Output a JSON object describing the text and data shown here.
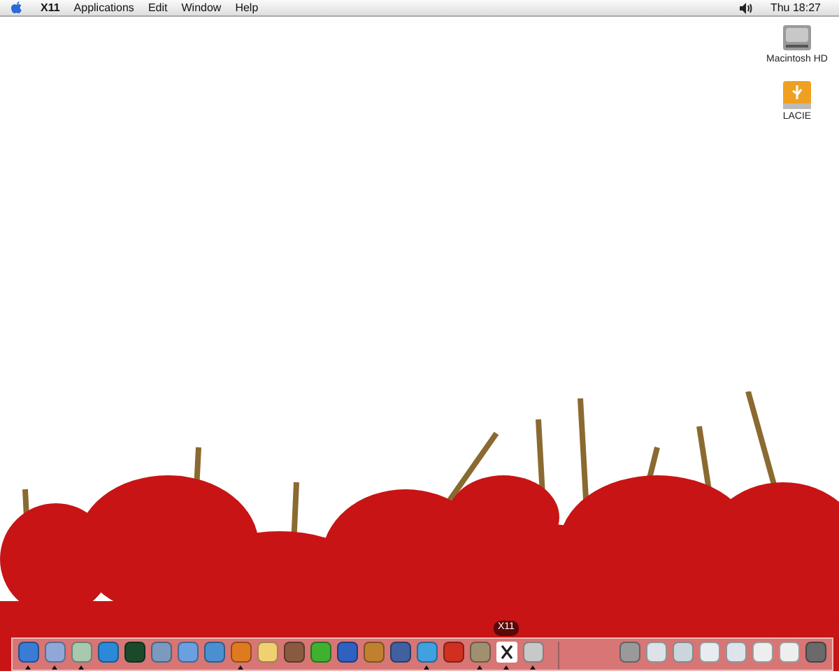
{
  "menu_bar": {
    "menus": [
      {
        "label": "X11",
        "bold": true
      },
      {
        "label": "Applications",
        "bold": false
      },
      {
        "label": "Edit",
        "bold": false
      },
      {
        "label": "Window",
        "bold": false
      },
      {
        "label": "Help",
        "bold": false
      }
    ],
    "clock": "Thu 18:27"
  },
  "desktop_icons": [
    {
      "label": "Macintosh HD",
      "kind": "disk"
    },
    {
      "label": "LACIE",
      "kind": "usb"
    }
  ],
  "dock": {
    "apps": [
      {
        "kind": "app",
        "color": "#3a7bd5",
        "running": true
      },
      {
        "kind": "app",
        "color": "#8fa8d8",
        "running": true
      },
      {
        "kind": "app",
        "color": "#a8c8b0",
        "running": true
      },
      {
        "kind": "app",
        "color": "#2a8ad8",
        "running": false
      },
      {
        "kind": "app",
        "color": "#1a4a2a",
        "running": false
      },
      {
        "kind": "app",
        "color": "#7a9ac0",
        "running": false
      },
      {
        "kind": "app",
        "color": "#6aa0e0",
        "running": false
      },
      {
        "kind": "app",
        "color": "#4a90d0",
        "running": false
      },
      {
        "kind": "app",
        "color": "#e07a20",
        "running": true
      },
      {
        "kind": "app",
        "color": "#f0d070",
        "running": false
      },
      {
        "kind": "app",
        "color": "#8a5a40",
        "running": false
      },
      {
        "kind": "app",
        "color": "#40b030",
        "running": false
      },
      {
        "kind": "app",
        "color": "#3060c0",
        "running": false
      },
      {
        "kind": "app",
        "color": "#c08030",
        "running": false
      },
      {
        "kind": "app",
        "color": "#4060a0",
        "running": false
      },
      {
        "kind": "app",
        "color": "#40a0e0",
        "running": true
      },
      {
        "kind": "app",
        "color": "#d03020",
        "running": false
      },
      {
        "kind": "app",
        "color": "#a09070",
        "running": true
      },
      {
        "kind": "x11",
        "color": "#ffffff",
        "running": true,
        "tooltip": "X11"
      },
      {
        "kind": "app",
        "color": "#c8c8c8",
        "running": true
      }
    ],
    "others": [
      {
        "color": "#9a9a9a"
      },
      {
        "color": "#dde2e8"
      },
      {
        "color": "#ccd4dc"
      },
      {
        "color": "#e8ecf0"
      },
      {
        "color": "#dde4ec"
      },
      {
        "color": "#eeeeee"
      },
      {
        "color": "#eeeeee"
      },
      {
        "color": "#6a6a6a"
      }
    ]
  }
}
